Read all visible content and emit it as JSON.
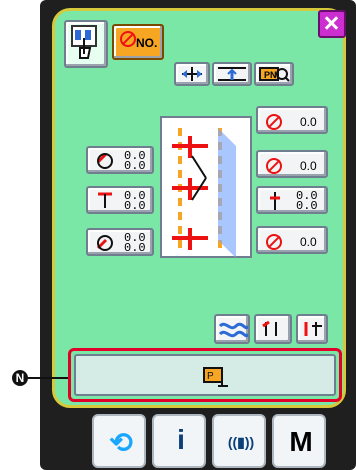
{
  "panel": {
    "close_label": "×",
    "top_no_label": "NO.",
    "pn_label": "PN",
    "values": {
      "top_right": "0.0",
      "right_mid": "0.0",
      "right_low": "0.0",
      "right_bottom": "0.0",
      "left_1a": "0.0",
      "left_1b": "0.0",
      "left_2a": "0.0",
      "left_2b": "0.0",
      "left_3a": "0.0",
      "left_3b": "0.0",
      "mid_right_a": "0.0",
      "mid_right_b": "0.0"
    }
  },
  "callout": {
    "letter": "N"
  },
  "bottom_nav": {
    "items": [
      {
        "name": "refresh",
        "label": "⟲"
      },
      {
        "name": "info",
        "label": "i"
      },
      {
        "name": "communication",
        "label": "((▮))"
      },
      {
        "name": "mode",
        "label": "M"
      }
    ]
  }
}
